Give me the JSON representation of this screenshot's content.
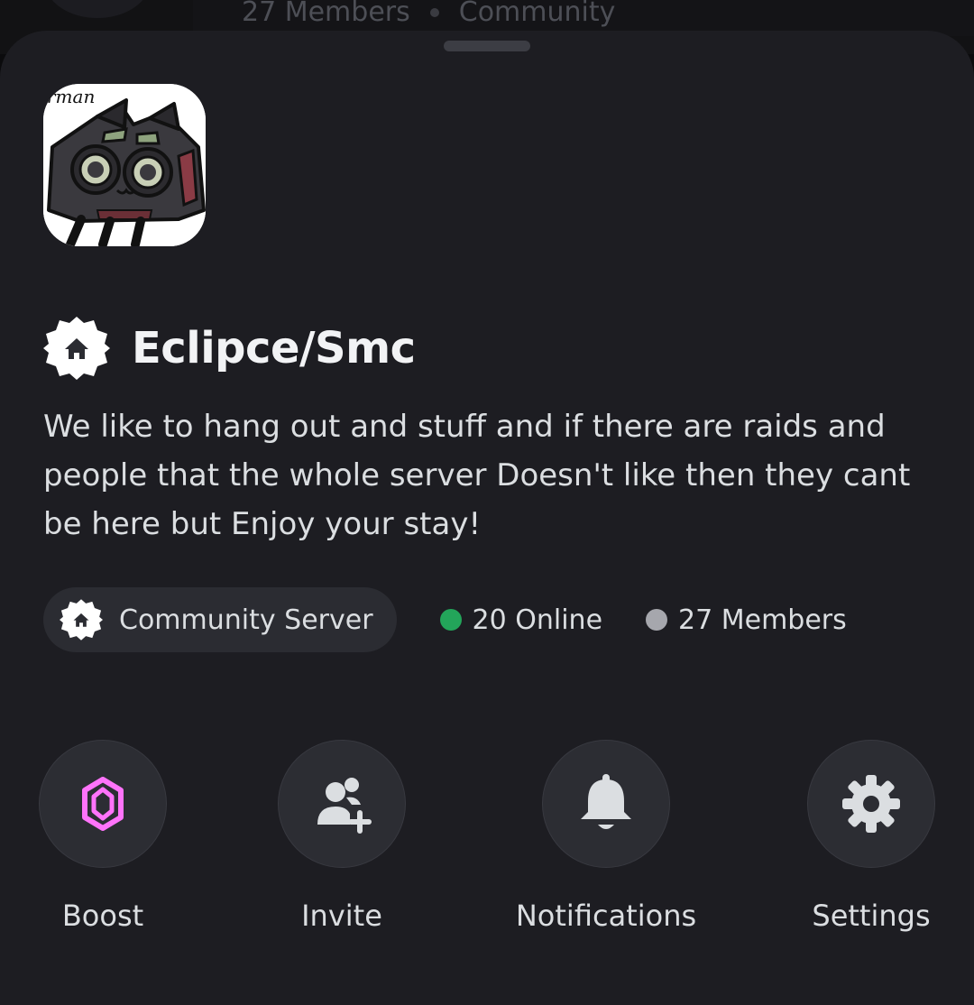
{
  "backdrop": {
    "members_text": "27 Members",
    "type_text": "Community"
  },
  "server": {
    "icon_name": "server-avatar-image",
    "icon_caption": "rman",
    "name": "Eclipce/Smc",
    "badge_icon": "community-home-badge-icon",
    "description": "We like to hang out and stuff and if there are raids and people that the whole server Doesn't like then they cant be here but Enjoy your stay!"
  },
  "stats": {
    "community_label": "Community Server",
    "online_label": "20 Online",
    "online_color": "#23a55a",
    "members_label": "27 Members",
    "members_color": "#a6a7ad"
  },
  "actions": [
    {
      "label": "Boost",
      "icon": "boost-gem-icon",
      "icon_color": "#ff73fa"
    },
    {
      "label": "Invite",
      "icon": "add-user-icon",
      "icon_color": "#dbdee1"
    },
    {
      "label": "Notifications",
      "icon": "bell-icon",
      "icon_color": "#dbdee1"
    },
    {
      "label": "Settings",
      "icon": "gear-icon",
      "icon_color": "#dbdee1"
    }
  ],
  "colors": {
    "sheet_background": "#1d1d22",
    "pill_background": "#2b2c32",
    "text_primary": "#f2f3f5"
  }
}
